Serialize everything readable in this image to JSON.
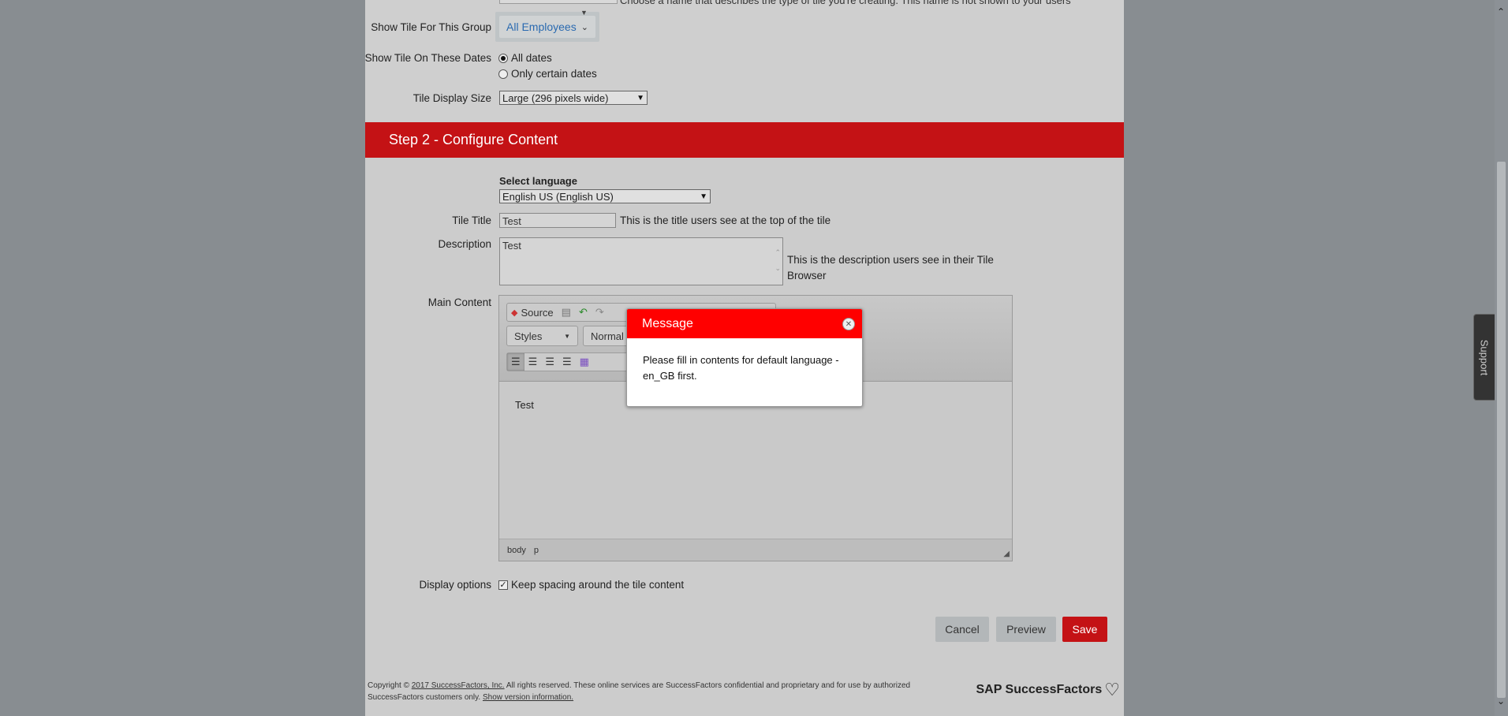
{
  "form": {
    "top_hint": "Choose a name that describes the type of tile you're creating. This name is not shown to your users",
    "group_label": "Show Tile For This Group",
    "group_value": "All Employees",
    "dates_label": "Show Tile On These Dates",
    "dates_options": [
      "All dates",
      "Only certain dates"
    ],
    "size_label": "Tile Display Size",
    "size_value": "Large (296 pixels wide)"
  },
  "step2": {
    "title": "Step 2 - Configure Content",
    "select_language_label": "Select language",
    "language_value": "English US (English US)",
    "tile_title_label": "Tile Title",
    "tile_title_value": "Test",
    "tile_title_hint": "This is the title users see at the top of the tile",
    "description_label": "Description",
    "description_value": "Test",
    "description_hint_line1": "This is the description users see in their Tile",
    "description_hint_line2": "Browser",
    "main_content_label": "Main Content",
    "display_options_label": "Display options",
    "keep_spacing_label": "Keep spacing around the tile content"
  },
  "editor": {
    "source_label": "Source",
    "styles_label": "Styles",
    "format_label": "Normal",
    "content": "Test",
    "path": [
      "body",
      "p"
    ]
  },
  "buttons": {
    "cancel": "Cancel",
    "preview": "Preview",
    "save": "Save"
  },
  "footer": {
    "copyright_prefix": "Copyright ©",
    "copyright_link": "2017 SuccessFactors, Inc.",
    "copyright_text": "All rights reserved. These online services are SuccessFactors confidential and proprietary and for use by authorized SuccessFactors customers only.",
    "version_link": "Show version information.",
    "logo_text": "SAP SuccessFactors"
  },
  "modal": {
    "title": "Message",
    "line1": "Please fill in contents for default language -",
    "line2": "en_GB first."
  },
  "support_tab": "Support"
}
